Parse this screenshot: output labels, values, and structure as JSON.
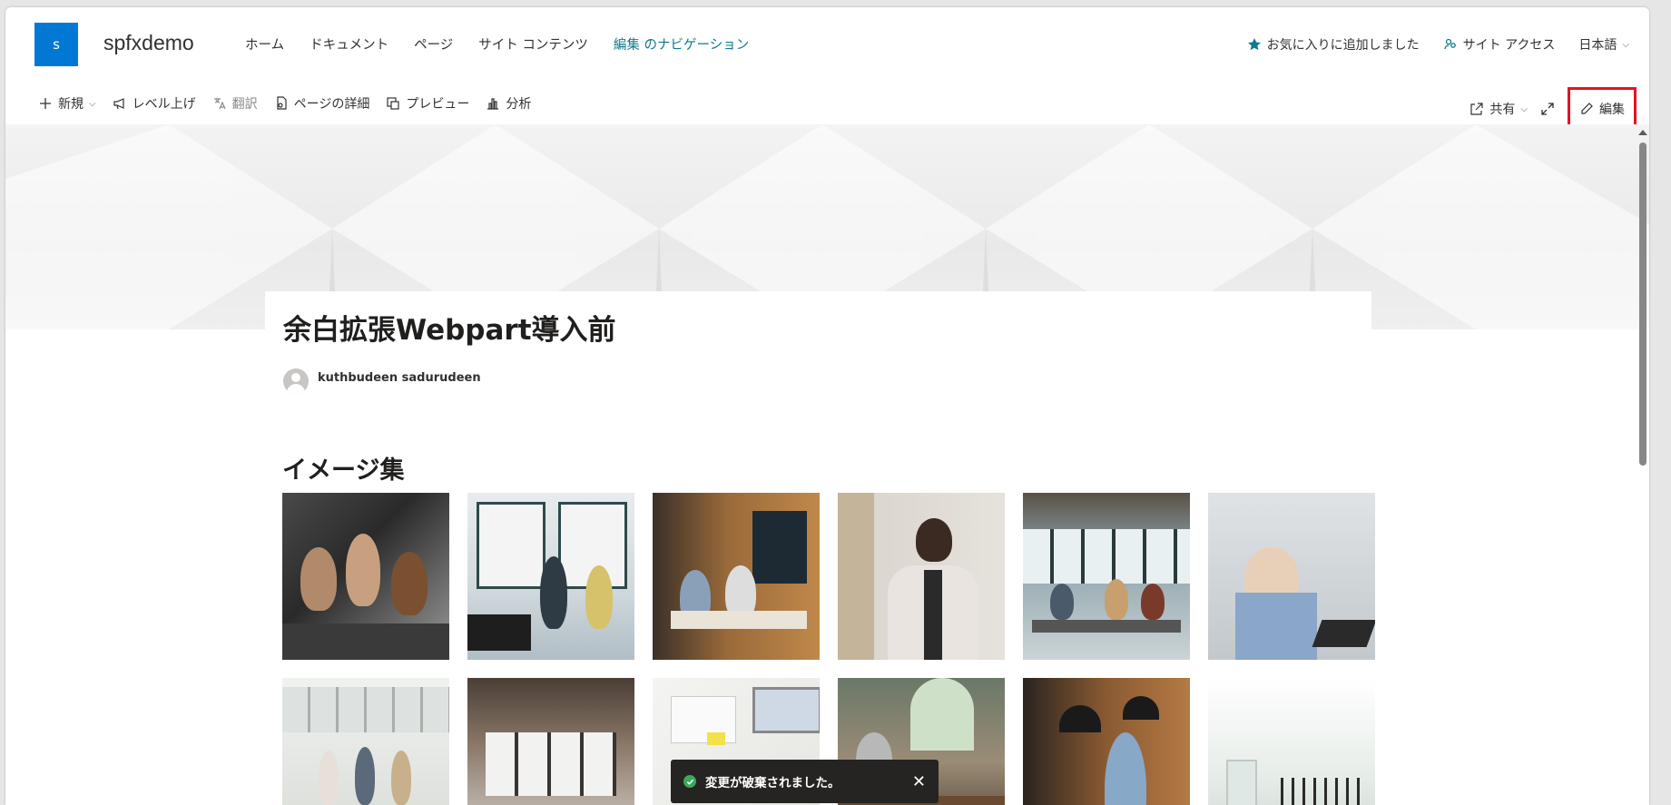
{
  "site": {
    "logo_letter": "s",
    "title": "spfxdemo",
    "nav": [
      "ホーム",
      "ドキュメント",
      "ページ",
      "サイト コンテンツ",
      "編集 のナビゲーション"
    ],
    "favorite": "お気に入りに追加しました",
    "access": "サイト アクセス",
    "language": "日本語"
  },
  "commandbar": {
    "new": "新規",
    "promote": "レベル上げ",
    "translate": "翻訳",
    "page_details": "ページの詳細",
    "preview": "プレビュー",
    "analytics": "分析",
    "share": "共有",
    "edit": "編集"
  },
  "page": {
    "title": "余白拡張Webpart導入前",
    "author": "kuthbudeen sadurudeen",
    "gallery_title": "イメージ集"
  },
  "toast": {
    "message": "変更が破棄されました。"
  },
  "colors": {
    "brand": "#0078d4",
    "nav_accent": "#0f7a8c",
    "edit_highlight": "#e81123",
    "toast_bg": "#252423"
  }
}
